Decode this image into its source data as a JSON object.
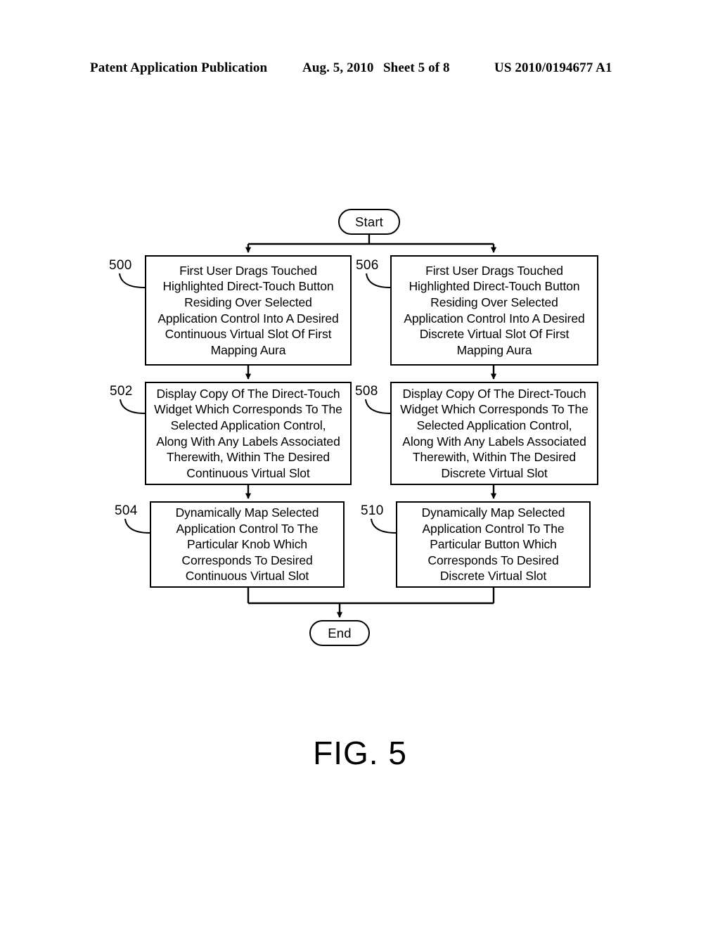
{
  "header": {
    "publication": "Patent Application Publication",
    "date": "Aug. 5, 2010",
    "sheet": "Sheet 5 of 8",
    "document_number": "US 2010/0194677 A1"
  },
  "figure": {
    "caption": "FIG. 5"
  },
  "flowchart": {
    "start_label": "Start",
    "end_label": "End",
    "nodes": [
      {
        "ref": "500",
        "text": "First User Drags Touched\nHighlighted Direct-Touch Button\nResiding Over Selected\nApplication Control Into A Desired\nContinuous Virtual Slot Of First\nMapping Aura"
      },
      {
        "ref": "502",
        "text": "Display Copy Of The Direct-Touch\nWidget Which Corresponds To The\nSelected Application Control,\nAlong With Any Labels Associated\nTherewith, Within The Desired\nContinuous Virtual Slot"
      },
      {
        "ref": "504",
        "text": "Dynamically Map Selected\nApplication Control To The\nParticular Knob Which\nCorresponds To Desired\nContinuous Virtual Slot"
      },
      {
        "ref": "506",
        "text": "First User Drags Touched\nHighlighted Direct-Touch Button\nResiding Over Selected\nApplication Control Into A Desired\nDiscrete Virtual Slot Of First\nMapping Aura"
      },
      {
        "ref": "508",
        "text": "Display Copy Of The Direct-Touch\nWidget Which Corresponds To The\nSelected Application Control,\nAlong With Any Labels Associated\nTherewith, Within The Desired\nDiscrete Virtual Slot"
      },
      {
        "ref": "510",
        "text": "Dynamically Map Selected\nApplication Control To The\nParticular Button Which\nCorresponds To Desired\nDiscrete Virtual Slot"
      }
    ]
  }
}
